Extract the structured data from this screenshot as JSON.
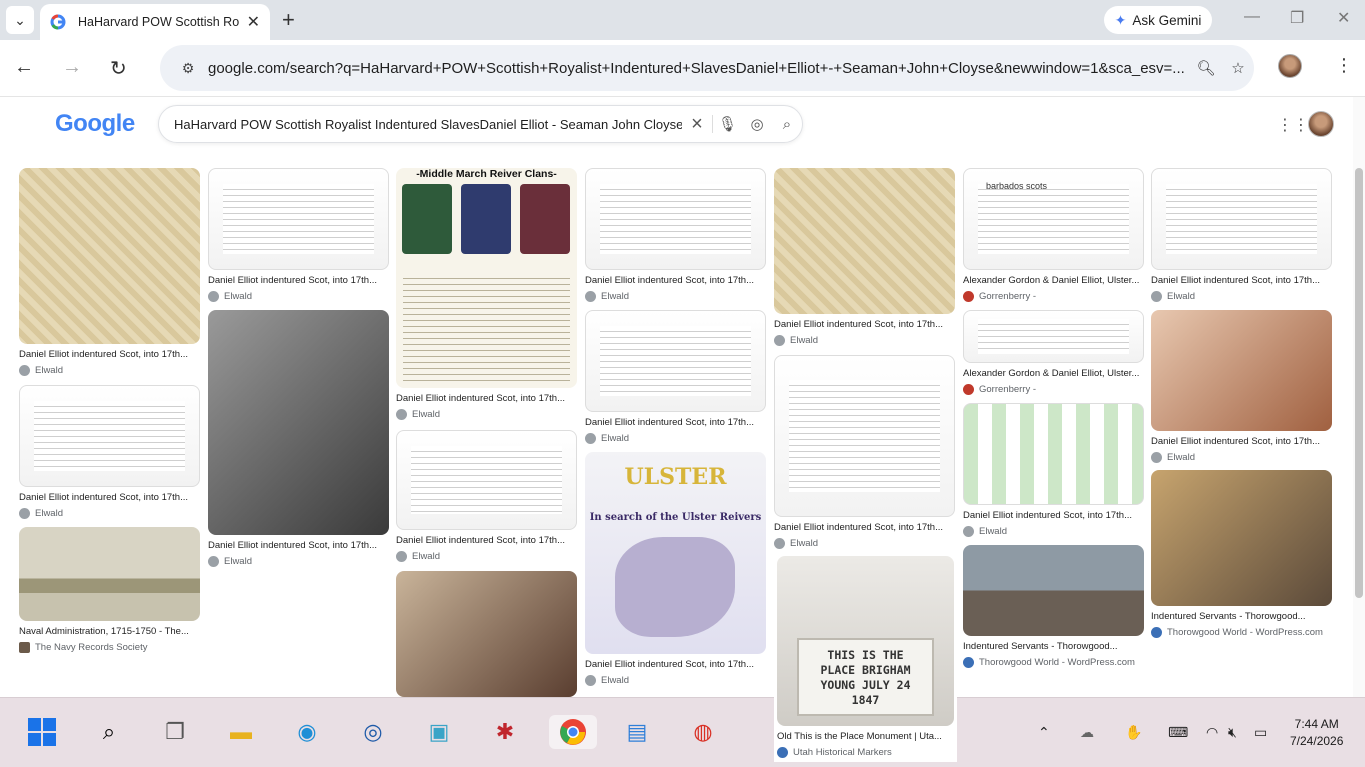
{
  "browser": {
    "tab_title": "HaHarvard POW Scottish Ro",
    "gemini_label": "Ask Gemini",
    "url": "google.com/search?q=HaHarvard+POW+Scottish+Royalist+Indentured+SlavesDaniel+Elliot+-+Seaman+John+Cloyse&newwindow=1&sca_esv=..."
  },
  "google": {
    "logo": "Google",
    "query": "HaHarvard POW Scottish Royalist Indentured SlavesDaniel Elliot - Seaman John Cloyse"
  },
  "results": [
    {
      "caption": "Daniel Elliot indentured Scot, into 17th...",
      "source": "Elwald"
    },
    {
      "caption": "Daniel Elliot indentured Scot, into 17th...",
      "source": "Elwald"
    },
    {
      "caption": "Naval Administration, 1715-1750 - The...",
      "source": "The Navy Records Society"
    },
    {
      "caption": "Daniel Elliot indentured Scot, into 17th...",
      "source": "Elwald"
    },
    {
      "caption": "Daniel Elliot indentured Scot, into 17th...",
      "source": "Elwald"
    },
    {
      "caption": "Daniel Elliot indentured Scot, into 17th...",
      "source": "Elwald"
    },
    {
      "caption": "Daniel Elliot indentured Scot, into 17th...",
      "source": "Elwald"
    },
    {
      "caption": "Daniel Elliot indentured Scot, into 17th...",
      "source": "Elwald"
    },
    {
      "caption": "Daniel Elliot indentured Scot, into 17th...",
      "source": "Elwald"
    },
    {
      "caption": "Daniel Elliot indentured Scot, into 17th...",
      "source": "Elwald"
    },
    {
      "caption": "Daniel Elliot indentured Scot, into 17th...",
      "source": "Elwald"
    },
    {
      "caption": "Daniel Elliot indentured Scot, into 17th...",
      "source": "Elwald"
    },
    {
      "caption": "Old This is the Place Monument | Uta...",
      "source": "Utah Historical Markers"
    },
    {
      "caption": "Alexander Gordon & Daniel Elliot, Ulster...",
      "source": "Gorrenberry -"
    },
    {
      "caption": "Alexander Gordon & Daniel Elliot, Ulster...",
      "source": "Gorrenberry -"
    },
    {
      "caption": "Daniel Elliot indentured Scot, into 17th...",
      "source": "Elwald"
    },
    {
      "caption": "Indentured Servants - Thorowgood...",
      "source": "Thorowgood World - WordPress.com"
    },
    {
      "caption": "Daniel Elliot indentured Scot, into 17th...",
      "source": "Elwald"
    },
    {
      "caption": "Daniel Elliot indentured Scot, into 17th...",
      "source": "Elwald"
    },
    {
      "caption": "Indentured Servants - Thorowgood...",
      "source": "Thorowgood World - WordPress.com"
    }
  ],
  "thumb_text": {
    "clans": "-Middle March Reiver Clans-",
    "ulster": "ULSTER",
    "ulster_sub": "In search of the Ulster Reivers",
    "plaque": "THIS IS THE PLACE BRIGHAM YOUNG JULY 24 1847",
    "barbados": "barbados scots"
  },
  "taskbar": {
    "time": "7:44 AM",
    "date": "7/24/2026"
  }
}
